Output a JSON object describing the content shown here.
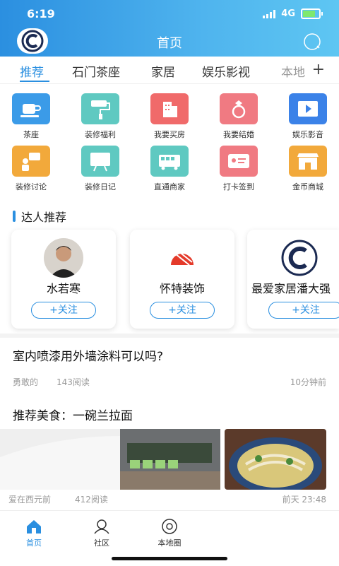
{
  "status_bar": {
    "time": "6:19",
    "network": "4G"
  },
  "header": {
    "title": "首页"
  },
  "tabs": [
    "推荐",
    "石门茶座",
    "家居",
    "娱乐影视",
    "本地"
  ],
  "grid": [
    {
      "label": "茶座",
      "icon": "teacup-icon",
      "color": "#3b9be8"
    },
    {
      "label": "装修福利",
      "icon": "paint-roller-icon",
      "color": "#5fc9c1"
    },
    {
      "label": "我要买房",
      "icon": "building-icon",
      "color": "#f06a6a"
    },
    {
      "label": "我要结婚",
      "icon": "ring-icon",
      "color": "#f07a82"
    },
    {
      "label": "娱乐影音",
      "icon": "video-icon",
      "color": "#3b82e8"
    },
    {
      "label": "装修讨论",
      "icon": "discussion-icon",
      "color": "#f2a93b"
    },
    {
      "label": "装修日记",
      "icon": "whiteboard-icon",
      "color": "#5fc9c1"
    },
    {
      "label": "直通商家",
      "icon": "bus-icon",
      "color": "#5fc9c1"
    },
    {
      "label": "打卡签到",
      "icon": "id-card-icon",
      "color": "#f07a82"
    },
    {
      "label": "金币商城",
      "icon": "shop-icon",
      "color": "#f2a93b"
    }
  ],
  "experts": {
    "title": "达人推荐",
    "follow_label": "+关注",
    "cards": [
      {
        "name": "水若寒"
      },
      {
        "name": "怀特装饰"
      },
      {
        "name": "最爱家居潘大强"
      }
    ]
  },
  "articles": [
    {
      "title": "室内喷漆用外墙涂料可以吗?",
      "author": "勇敢的",
      "reads": "143阅读",
      "time": "10分钟前"
    },
    {
      "title": "推荐美食：一碗兰拉面",
      "author": "爱在西元前",
      "reads": "412阅读",
      "time": "前天 23:48"
    }
  ],
  "bottom_nav": [
    "首页",
    "社区",
    "本地圈"
  ]
}
